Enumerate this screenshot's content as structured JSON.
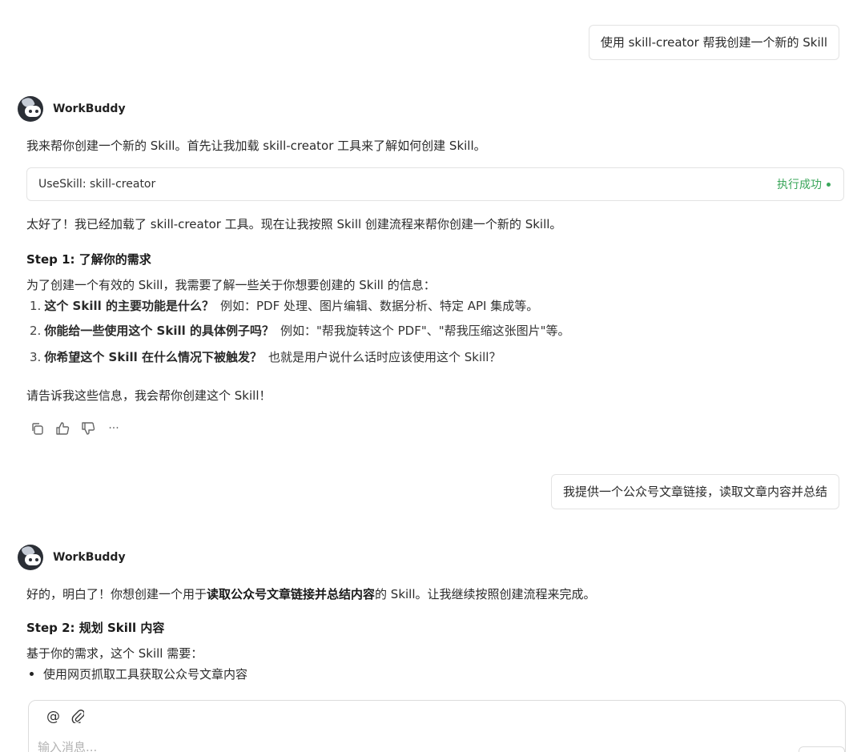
{
  "messages": {
    "user1": "使用 skill-creator 帮我创建一个新的 Skill",
    "agent1": {
      "name": "WorkBuddy",
      "intro": "我来帮你创建一个新的 Skill。首先让我加载 skill-creator 工具来了解如何创建 Skill。",
      "tool": {
        "name": "UseSkill: skill-creator",
        "status": "执行成功"
      },
      "loaded": "太好了！我已经加载了 skill-creator 工具。现在让我按照 Skill 创建流程来帮你创建一个新的 Skill。",
      "step_title": "Step 1: 了解你的需求",
      "step_desc": "为了创建一个有效的 Skill，我需要了解一些关于你想要创建的 Skill 的信息：",
      "questions": [
        {
          "num": "1.",
          "q": "这个 Skill 的主要功能是什么？",
          "hint": "例如：PDF 处理、图片编辑、数据分析、特定 API 集成等。"
        },
        {
          "num": "2.",
          "q": "你能给一些使用这个 Skill 的具体例子吗？",
          "hint": "例如：\"帮我旋转这个 PDF\"、\"帮我压缩这张图片\"等。"
        },
        {
          "num": "3.",
          "q": "你希望这个 Skill 在什么情况下被触发？",
          "hint": "也就是用户说什么话时应该使用这个 Skill？"
        }
      ],
      "closing": "请告诉我这些信息，我会帮你创建这个 Skill！"
    },
    "user2": "我提供一个公众号文章链接，读取文章内容并总结",
    "agent2": {
      "name": "WorkBuddy",
      "intro_pre": "好的，明白了！你想创建一个用于",
      "intro_bold": "读取公众号文章链接并总结内容",
      "intro_post": "的 Skill。让我继续按照创建流程来完成。",
      "step_title": "Step 2: 规划 Skill 内容",
      "step_desc": "基于你的需求，这个 Skill 需要：",
      "bullets": [
        "使用网页抓取工具获取公众号文章内容"
      ]
    }
  },
  "actions": {
    "icons": [
      "copy-icon",
      "thumbs-up-icon",
      "thumbs-down-icon",
      "more-icon"
    ],
    "more_label": "···"
  },
  "composer": {
    "placeholder": "输入消息...",
    "tools": {
      "mention": "@",
      "attach": "⌀"
    }
  },
  "colors": {
    "success": "#3aa65a",
    "border": "#e3e3e3"
  }
}
